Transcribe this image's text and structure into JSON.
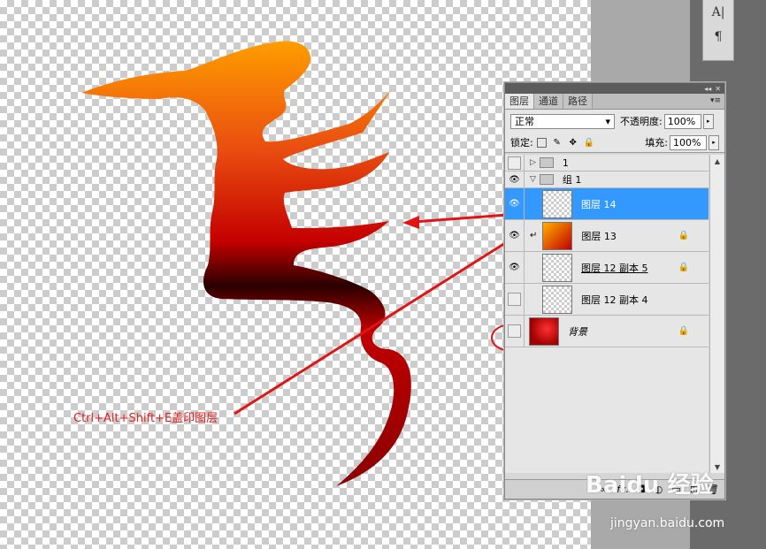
{
  "panel": {
    "tabs": [
      "图层",
      "通道",
      "路径"
    ],
    "blend_mode": "正常",
    "opacity_label": "不透明度:",
    "opacity_value": "100%",
    "lock_label": "锁定:",
    "fill_label": "填充:",
    "fill_value": "100%",
    "layers": [
      {
        "name": "1",
        "kind": "group",
        "visible": false,
        "expanded": false
      },
      {
        "name": "组 1",
        "kind": "group",
        "visible": true,
        "expanded": true
      },
      {
        "name": "图层 14",
        "kind": "layer",
        "visible": true,
        "selected": true
      },
      {
        "name": "图层 13",
        "kind": "layer",
        "visible": true,
        "clipped": true,
        "locked": true
      },
      {
        "name": "图层 12 副本 5",
        "kind": "layer",
        "visible": true,
        "locked": true
      },
      {
        "name": "图层 12 副本 4",
        "kind": "layer",
        "visible": false
      },
      {
        "name": "背景",
        "kind": "background",
        "visible": false,
        "locked": true
      }
    ],
    "footer_icons": [
      "link-icon",
      "fx-icon",
      "mask-icon",
      "adjustment-icon",
      "folder-icon",
      "new-layer-icon",
      "trash-icon"
    ]
  },
  "annotation": {
    "text": "Ctrl+Alt+Shift+E盖印图层",
    "color": "#e02020"
  },
  "toolstrip": [
    "A|",
    "¶"
  ],
  "watermark": {
    "brand": "Baidu 经验",
    "url": "jingyan.baidu.com"
  }
}
